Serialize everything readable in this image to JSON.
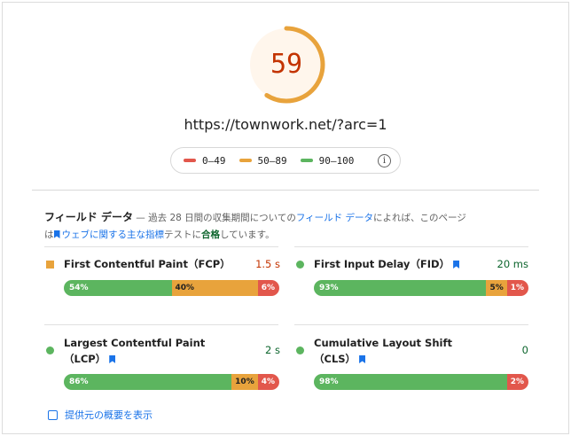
{
  "score": {
    "value": "59"
  },
  "url": "https://townwork.net/?arc=1",
  "legend": {
    "items": [
      {
        "label": "0–49",
        "color": "#e2574c"
      },
      {
        "label": "50–89",
        "color": "#e8a33c"
      },
      {
        "label": "90–100",
        "color": "#5cb55f"
      }
    ],
    "info_icon": "info-icon"
  },
  "field": {
    "title": "フィールド データ",
    "desc_1": " — 過去 28 日間の収集期間についての",
    "desc_link": "フィールド データ",
    "desc_2": "によれば、このページ",
    "desc_3": "は",
    "desc_link2": "ウェブに関する主な指標",
    "desc_4": "テストに",
    "desc_pass": "合格",
    "desc_5": "しています。"
  },
  "metrics": [
    {
      "name": "First Contentful Paint（FCP）",
      "value": "1.5 s",
      "icon": "orange-square-icon",
      "segments": [
        {
          "label": "54%",
          "pct": 54
        },
        {
          "label": "40%",
          "pct": 40
        },
        {
          "label": "6%",
          "pct": 6
        }
      ]
    },
    {
      "name": "First Input Delay（FID）",
      "value": "20 ms",
      "icon": "green-circle-icon",
      "segments": [
        {
          "label": "93%",
          "pct": 93
        },
        {
          "label": "5%",
          "pct": 5
        },
        {
          "label": "1%",
          "pct": 1
        }
      ]
    },
    {
      "name": "Largest Contentful Paint",
      "name2": "（LCP）",
      "value": "2 s",
      "icon": "green-circle-icon",
      "segments": [
        {
          "label": "86%",
          "pct": 86
        },
        {
          "label": "10%",
          "pct": 10
        },
        {
          "label": "4%",
          "pct": 4
        }
      ]
    },
    {
      "name": "Cumulative Layout Shift",
      "name2": "（CLS）",
      "value": "0",
      "icon": "green-circle-icon",
      "segments": [
        {
          "label": "98%",
          "pct": 98
        },
        {
          "label": "",
          "pct": 0
        },
        {
          "label": "2%",
          "pct": 2
        }
      ]
    }
  ],
  "footer": {
    "label": "提供元の概要を表示"
  }
}
